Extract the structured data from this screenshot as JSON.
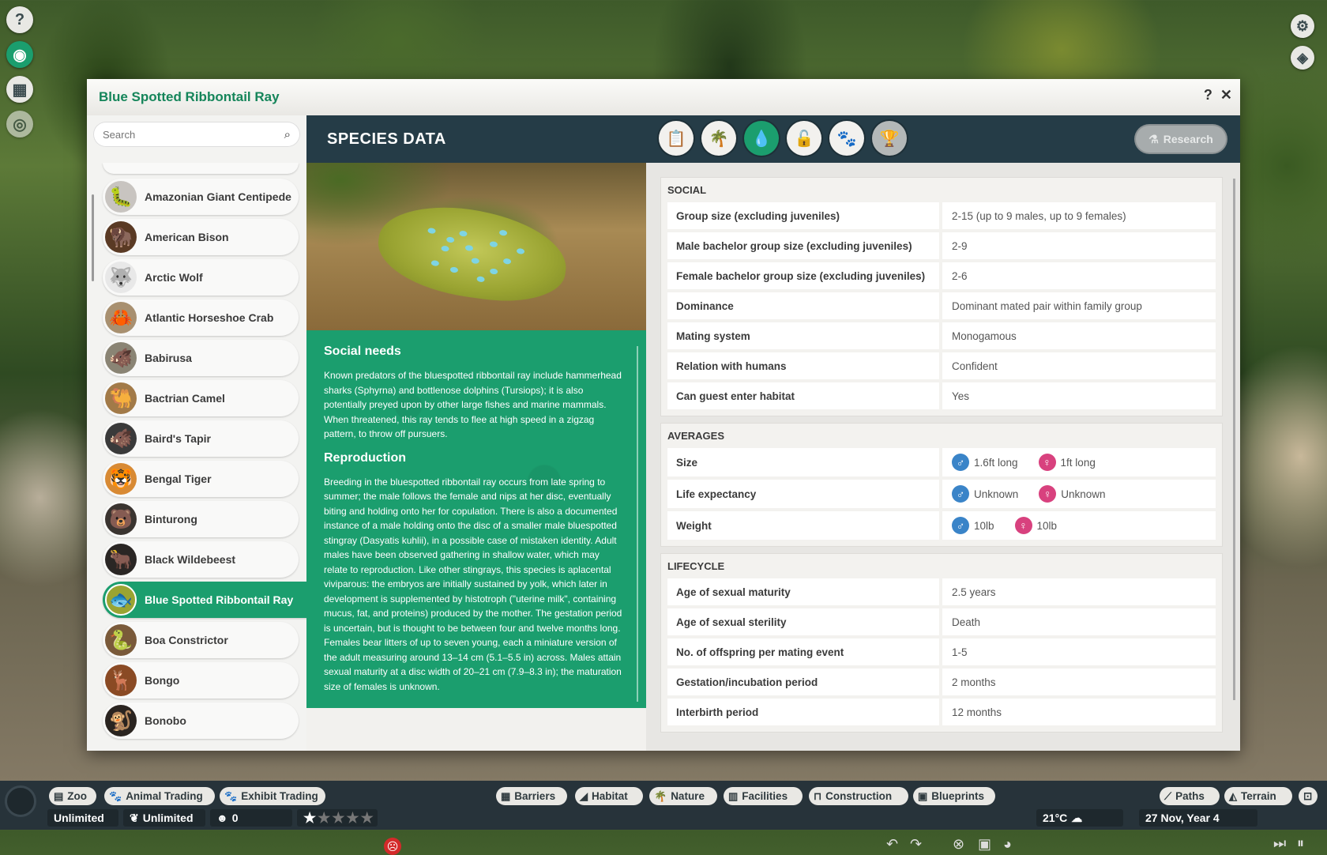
{
  "window": {
    "title": "Blue Spotted Ribbontail Ray"
  },
  "side_icons": [
    {
      "icon": "help-icon",
      "glyph": "?"
    },
    {
      "icon": "zoopedia-icon",
      "glyph": "◉"
    },
    {
      "icon": "calendar-icon",
      "glyph": "▦"
    },
    {
      "icon": "view-icon",
      "glyph": "◎"
    }
  ],
  "right_icons": [
    {
      "icon": "settings-icon",
      "glyph": "⚙"
    },
    {
      "icon": "camera-icon",
      "glyph": "◈"
    }
  ],
  "search": {
    "placeholder": "Search"
  },
  "species": [
    {
      "name": "Amazonian Giant Centipede",
      "glyph": "🐛",
      "color": "#c8c4c0"
    },
    {
      "name": "American Bison",
      "glyph": "🦬",
      "color": "#5a3a24"
    },
    {
      "name": "Arctic Wolf",
      "glyph": "🐺",
      "color": "#e8e8e8"
    },
    {
      "name": "Atlantic Horseshoe Crab",
      "glyph": "🦀",
      "color": "#a89070"
    },
    {
      "name": "Babirusa",
      "glyph": "🐗",
      "color": "#8a8474"
    },
    {
      "name": "Bactrian Camel",
      "glyph": "🐫",
      "color": "#a27a48"
    },
    {
      "name": "Baird's Tapir",
      "glyph": "🐗",
      "color": "#3a3a3a"
    },
    {
      "name": "Bengal Tiger",
      "glyph": "🐯",
      "color": "#d88a34"
    },
    {
      "name": "Binturong",
      "glyph": "🐻",
      "color": "#3a3430"
    },
    {
      "name": "Black Wildebeest",
      "glyph": "🐂",
      "color": "#2a2624"
    },
    {
      "name": "Blue Spotted Ribbontail Ray",
      "glyph": "🐟",
      "color": "#9aa432"
    },
    {
      "name": "Boa Constrictor",
      "glyph": "🐍",
      "color": "#7a5a3a"
    },
    {
      "name": "Bongo",
      "glyph": "🦌",
      "color": "#8a4a24"
    },
    {
      "name": "Bonobo",
      "glyph": "🐒",
      "color": "#2a2420"
    }
  ],
  "selected_species": "Blue Spotted Ribbontail Ray",
  "content": {
    "title": "SPECIES DATA",
    "tabs": [
      {
        "icon": "clipboard-icon",
        "glyph": "📋",
        "state": "normal"
      },
      {
        "icon": "habitat-icon",
        "glyph": "🌴",
        "state": "normal"
      },
      {
        "icon": "species-data-icon",
        "glyph": "💧",
        "state": "active"
      },
      {
        "icon": "enrichment-icon",
        "glyph": "🔓",
        "state": "normal"
      },
      {
        "icon": "paw-icon",
        "glyph": "🐾",
        "state": "normal"
      },
      {
        "icon": "trophy-icon",
        "glyph": "🏆",
        "state": "dim"
      }
    ],
    "research_label": "Research"
  },
  "text": {
    "social_heading": "Social needs",
    "social_body": "Known predators of the bluespotted ribbontail ray include hammerhead sharks (Sphyrna) and bottlenose dolphins (Tursiops); it is also potentially preyed upon by other large fishes and marine mammals. When threatened, this ray tends to flee at high speed in a zigzag pattern, to throw off pursuers.",
    "repro_heading": "Reproduction",
    "repro_body": "Breeding in the bluespotted ribbontail ray occurs from late spring to summer; the male follows the female and nips at her disc, eventually biting and holding onto her for copulation. There is also a documented instance of a male holding onto the disc of a smaller male bluespotted stingray (Dasyatis kuhlii), in a possible case of mistaken identity. Adult males have been observed gathering in shallow water, which may relate to reproduction.  Like other stingrays, this species is aplacental viviparous: the embryos are initially sustained by yolk, which later in development is supplemented by histotroph (\"uterine milk\", containing mucus, fat, and proteins) produced by the mother. The gestation period is uncertain, but is thought to be between four and twelve months long. Females bear litters of up to seven young, each a miniature version of the adult measuring around 13–14 cm (5.1–5.5 in) across. Males attain sexual maturity at a disc width of 20–21 cm (7.9–8.3 in); the maturation size of females is unknown."
  },
  "social": {
    "title": "SOCIAL",
    "rows": [
      {
        "label": "Group size (excluding juveniles)",
        "value": "2-15 (up to 9 males, up to 9 females)"
      },
      {
        "label": "Male bachelor group size (excluding juveniles)",
        "value": "2-9"
      },
      {
        "label": "Female bachelor group size (excluding juveniles)",
        "value": "2-6"
      },
      {
        "label": "Dominance",
        "value": "Dominant mated pair within family group"
      },
      {
        "label": "Mating system",
        "value": "Monogamous"
      },
      {
        "label": "Relation with humans",
        "value": "Confident"
      },
      {
        "label": "Can guest enter habitat",
        "value": "Yes"
      }
    ]
  },
  "averages": {
    "title": "AVERAGES",
    "rows": [
      {
        "label": "Size",
        "male": "1.6ft long",
        "female": "1ft long"
      },
      {
        "label": "Life expectancy",
        "male": "Unknown",
        "female": "Unknown"
      },
      {
        "label": "Weight",
        "male": "10lb",
        "female": "10lb"
      }
    ]
  },
  "lifecycle": {
    "title": "LIFECYCLE",
    "rows": [
      {
        "label": "Age of sexual maturity",
        "value": "2.5 years"
      },
      {
        "label": "Age of sexual sterility",
        "value": "Death"
      },
      {
        "label": "No. of offspring per mating event",
        "value": "1-5"
      },
      {
        "label": "Gestation/incubation period",
        "value": "2 months"
      },
      {
        "label": "Interbirth period",
        "value": "12 months"
      }
    ]
  },
  "bottombar": {
    "left_tabs": [
      {
        "label": "Zoo",
        "glyph": "▤"
      },
      {
        "label": "Animal Trading",
        "glyph": "🐾"
      },
      {
        "label": "Exhibit Trading",
        "glyph": "🐾"
      }
    ],
    "build_tabs": [
      {
        "label": "Barriers",
        "glyph": "▦"
      },
      {
        "label": "Habitat",
        "glyph": "◢"
      },
      {
        "label": "Nature",
        "glyph": "🌴"
      },
      {
        "label": "Facilities",
        "glyph": "▥"
      },
      {
        "label": "Construction",
        "glyph": "⊓"
      },
      {
        "label": "Blueprints",
        "glyph": "▣"
      }
    ],
    "right_tabs": [
      {
        "label": "Paths",
        "glyph": "⟋"
      },
      {
        "label": "Terrain",
        "glyph": "◭"
      }
    ],
    "money": "Unlimited",
    "conservation": "Unlimited",
    "guests": "0",
    "rating_stars": 1,
    "rating_max": 5,
    "temperature": "21°C",
    "date": "27 Nov, Year 4"
  }
}
